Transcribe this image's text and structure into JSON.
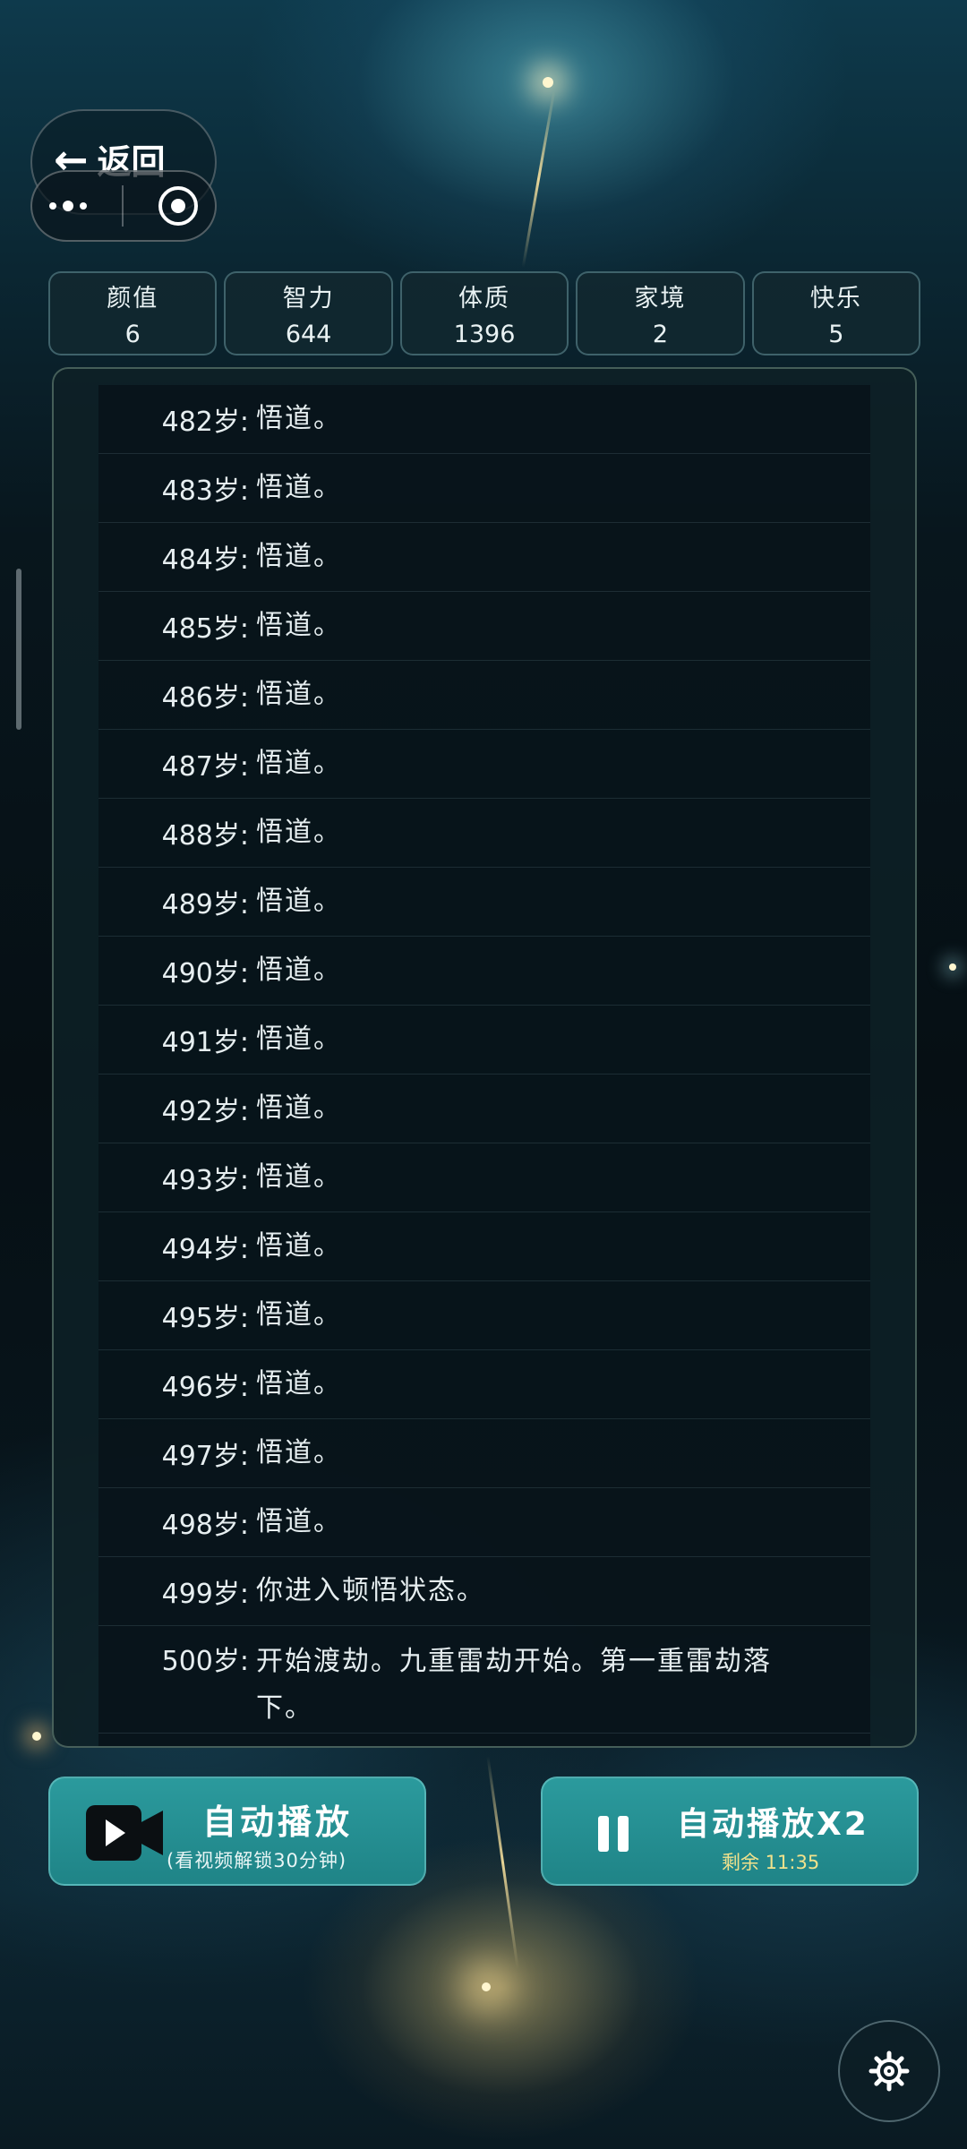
{
  "nav": {
    "back_label": "返回"
  },
  "stats": [
    {
      "label": "颜值",
      "value": "6"
    },
    {
      "label": "智力",
      "value": "644"
    },
    {
      "label": "体质",
      "value": "1396"
    },
    {
      "label": "家境",
      "value": "2"
    },
    {
      "label": "快乐",
      "value": "5"
    }
  ],
  "log": [
    {
      "age": "482岁:",
      "text": "悟道。"
    },
    {
      "age": "483岁:",
      "text": "悟道。"
    },
    {
      "age": "484岁:",
      "text": "悟道。"
    },
    {
      "age": "485岁:",
      "text": "悟道。"
    },
    {
      "age": "486岁:",
      "text": "悟道。"
    },
    {
      "age": "487岁:",
      "text": "悟道。"
    },
    {
      "age": "488岁:",
      "text": "悟道。"
    },
    {
      "age": "489岁:",
      "text": "悟道。"
    },
    {
      "age": "490岁:",
      "text": "悟道。"
    },
    {
      "age": "491岁:",
      "text": "悟道。"
    },
    {
      "age": "492岁:",
      "text": "悟道。"
    },
    {
      "age": "493岁:",
      "text": "悟道。"
    },
    {
      "age": "494岁:",
      "text": "悟道。"
    },
    {
      "age": "495岁:",
      "text": "悟道。"
    },
    {
      "age": "496岁:",
      "text": "悟道。"
    },
    {
      "age": "497岁:",
      "text": "悟道。"
    },
    {
      "age": "498岁:",
      "text": "悟道。"
    },
    {
      "age": "499岁:",
      "text": "你进入顿悟状态。"
    },
    {
      "age": "500岁:",
      "text": "开始渡劫。九重雷劫开始。第一重雷劫落下。"
    }
  ],
  "buttons": {
    "autoplay": {
      "title": "自动播放",
      "subtitle": "(看视频解锁30分钟)"
    },
    "autoplay_x2": {
      "title": "自动播放X2",
      "subtitle": "剩余 11:35"
    }
  },
  "colors": {
    "button_bg": "#2b9a9d",
    "remaining_text": "#f2e28c"
  }
}
